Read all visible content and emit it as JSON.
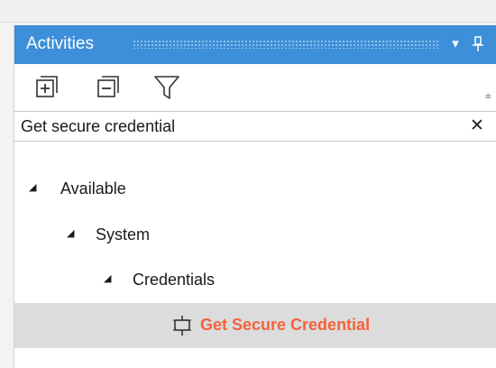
{
  "panel": {
    "title": "Activities",
    "dropdown_glyph": "▾",
    "pin_glyph": "ⵒ"
  },
  "toolbar": {
    "expand_all_icon": "expand-all-icon",
    "collapse_all_icon": "collapse-all-icon",
    "filter_icon": "filter-icon",
    "overflow_glyph": "⩧"
  },
  "search": {
    "value": "Get secure credential",
    "placeholder": "",
    "clear_glyph": "✕"
  },
  "tree": {
    "expander_glyph": "◢",
    "items": [
      {
        "label": "Available"
      },
      {
        "label": "System"
      },
      {
        "label": "Credentials"
      },
      {
        "label": "Get Secure Credential",
        "icon": "activity-icon"
      }
    ]
  },
  "colors": {
    "titlebar": "#3c8fd8",
    "highlight_text": "#f4623a",
    "selected_row": "#dcdcdc"
  }
}
